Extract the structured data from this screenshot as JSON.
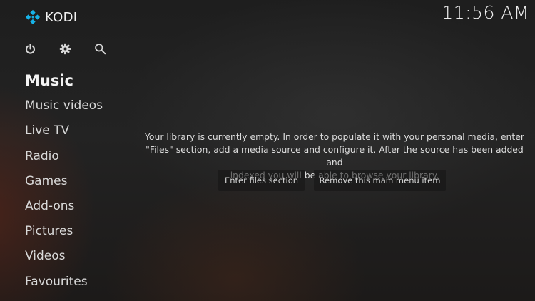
{
  "app": {
    "logo_text": "KODI",
    "clock": "11:56 AM"
  },
  "top_icons": [
    "power-icon",
    "gear-icon",
    "search-icon"
  ],
  "menu": {
    "items": [
      {
        "label": "Music",
        "active": true
      },
      {
        "label": "Music videos",
        "active": false
      },
      {
        "label": "Live TV",
        "active": false
      },
      {
        "label": "Radio",
        "active": false
      },
      {
        "label": "Games",
        "active": false
      },
      {
        "label": "Add-ons",
        "active": false
      },
      {
        "label": "Pictures",
        "active": false
      },
      {
        "label": "Videos",
        "active": false
      },
      {
        "label": "Favourites",
        "active": false
      }
    ]
  },
  "content": {
    "message_lines": [
      "Your library is currently empty. In order to populate it with your personal media, enter",
      "\"Files\" section, add a media source and configure it. After the source has been added and",
      "indexed you will be able to browse your library."
    ],
    "enter_files_label": "Enter files section",
    "remove_item_label": "Remove this main menu item"
  },
  "colors": {
    "text": "#e6e6e6",
    "kodi_blue": "#17b2e7"
  }
}
